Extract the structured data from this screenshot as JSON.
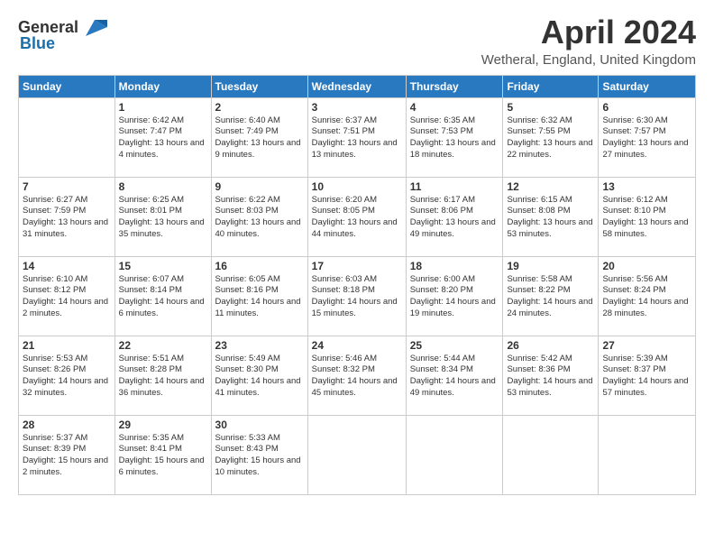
{
  "header": {
    "logo_general": "General",
    "logo_blue": "Blue",
    "title": "April 2024",
    "location": "Wetheral, England, United Kingdom"
  },
  "days_of_week": [
    "Sunday",
    "Monday",
    "Tuesday",
    "Wednesday",
    "Thursday",
    "Friday",
    "Saturday"
  ],
  "weeks": [
    [
      {
        "day": "",
        "sunrise": "",
        "sunset": "",
        "daylight": ""
      },
      {
        "day": "1",
        "sunrise": "Sunrise: 6:42 AM",
        "sunset": "Sunset: 7:47 PM",
        "daylight": "Daylight: 13 hours and 4 minutes."
      },
      {
        "day": "2",
        "sunrise": "Sunrise: 6:40 AM",
        "sunset": "Sunset: 7:49 PM",
        "daylight": "Daylight: 13 hours and 9 minutes."
      },
      {
        "day": "3",
        "sunrise": "Sunrise: 6:37 AM",
        "sunset": "Sunset: 7:51 PM",
        "daylight": "Daylight: 13 hours and 13 minutes."
      },
      {
        "day": "4",
        "sunrise": "Sunrise: 6:35 AM",
        "sunset": "Sunset: 7:53 PM",
        "daylight": "Daylight: 13 hours and 18 minutes."
      },
      {
        "day": "5",
        "sunrise": "Sunrise: 6:32 AM",
        "sunset": "Sunset: 7:55 PM",
        "daylight": "Daylight: 13 hours and 22 minutes."
      },
      {
        "day": "6",
        "sunrise": "Sunrise: 6:30 AM",
        "sunset": "Sunset: 7:57 PM",
        "daylight": "Daylight: 13 hours and 27 minutes."
      }
    ],
    [
      {
        "day": "7",
        "sunrise": "Sunrise: 6:27 AM",
        "sunset": "Sunset: 7:59 PM",
        "daylight": "Daylight: 13 hours and 31 minutes."
      },
      {
        "day": "8",
        "sunrise": "Sunrise: 6:25 AM",
        "sunset": "Sunset: 8:01 PM",
        "daylight": "Daylight: 13 hours and 35 minutes."
      },
      {
        "day": "9",
        "sunrise": "Sunrise: 6:22 AM",
        "sunset": "Sunset: 8:03 PM",
        "daylight": "Daylight: 13 hours and 40 minutes."
      },
      {
        "day": "10",
        "sunrise": "Sunrise: 6:20 AM",
        "sunset": "Sunset: 8:05 PM",
        "daylight": "Daylight: 13 hours and 44 minutes."
      },
      {
        "day": "11",
        "sunrise": "Sunrise: 6:17 AM",
        "sunset": "Sunset: 8:06 PM",
        "daylight": "Daylight: 13 hours and 49 minutes."
      },
      {
        "day": "12",
        "sunrise": "Sunrise: 6:15 AM",
        "sunset": "Sunset: 8:08 PM",
        "daylight": "Daylight: 13 hours and 53 minutes."
      },
      {
        "day": "13",
        "sunrise": "Sunrise: 6:12 AM",
        "sunset": "Sunset: 8:10 PM",
        "daylight": "Daylight: 13 hours and 58 minutes."
      }
    ],
    [
      {
        "day": "14",
        "sunrise": "Sunrise: 6:10 AM",
        "sunset": "Sunset: 8:12 PM",
        "daylight": "Daylight: 14 hours and 2 minutes."
      },
      {
        "day": "15",
        "sunrise": "Sunrise: 6:07 AM",
        "sunset": "Sunset: 8:14 PM",
        "daylight": "Daylight: 14 hours and 6 minutes."
      },
      {
        "day": "16",
        "sunrise": "Sunrise: 6:05 AM",
        "sunset": "Sunset: 8:16 PM",
        "daylight": "Daylight: 14 hours and 11 minutes."
      },
      {
        "day": "17",
        "sunrise": "Sunrise: 6:03 AM",
        "sunset": "Sunset: 8:18 PM",
        "daylight": "Daylight: 14 hours and 15 minutes."
      },
      {
        "day": "18",
        "sunrise": "Sunrise: 6:00 AM",
        "sunset": "Sunset: 8:20 PM",
        "daylight": "Daylight: 14 hours and 19 minutes."
      },
      {
        "day": "19",
        "sunrise": "Sunrise: 5:58 AM",
        "sunset": "Sunset: 8:22 PM",
        "daylight": "Daylight: 14 hours and 24 minutes."
      },
      {
        "day": "20",
        "sunrise": "Sunrise: 5:56 AM",
        "sunset": "Sunset: 8:24 PM",
        "daylight": "Daylight: 14 hours and 28 minutes."
      }
    ],
    [
      {
        "day": "21",
        "sunrise": "Sunrise: 5:53 AM",
        "sunset": "Sunset: 8:26 PM",
        "daylight": "Daylight: 14 hours and 32 minutes."
      },
      {
        "day": "22",
        "sunrise": "Sunrise: 5:51 AM",
        "sunset": "Sunset: 8:28 PM",
        "daylight": "Daylight: 14 hours and 36 minutes."
      },
      {
        "day": "23",
        "sunrise": "Sunrise: 5:49 AM",
        "sunset": "Sunset: 8:30 PM",
        "daylight": "Daylight: 14 hours and 41 minutes."
      },
      {
        "day": "24",
        "sunrise": "Sunrise: 5:46 AM",
        "sunset": "Sunset: 8:32 PM",
        "daylight": "Daylight: 14 hours and 45 minutes."
      },
      {
        "day": "25",
        "sunrise": "Sunrise: 5:44 AM",
        "sunset": "Sunset: 8:34 PM",
        "daylight": "Daylight: 14 hours and 49 minutes."
      },
      {
        "day": "26",
        "sunrise": "Sunrise: 5:42 AM",
        "sunset": "Sunset: 8:36 PM",
        "daylight": "Daylight: 14 hours and 53 minutes."
      },
      {
        "day": "27",
        "sunrise": "Sunrise: 5:39 AM",
        "sunset": "Sunset: 8:37 PM",
        "daylight": "Daylight: 14 hours and 57 minutes."
      }
    ],
    [
      {
        "day": "28",
        "sunrise": "Sunrise: 5:37 AM",
        "sunset": "Sunset: 8:39 PM",
        "daylight": "Daylight: 15 hours and 2 minutes."
      },
      {
        "day": "29",
        "sunrise": "Sunrise: 5:35 AM",
        "sunset": "Sunset: 8:41 PM",
        "daylight": "Daylight: 15 hours and 6 minutes."
      },
      {
        "day": "30",
        "sunrise": "Sunrise: 5:33 AM",
        "sunset": "Sunset: 8:43 PM",
        "daylight": "Daylight: 15 hours and 10 minutes."
      },
      {
        "day": "",
        "sunrise": "",
        "sunset": "",
        "daylight": ""
      },
      {
        "day": "",
        "sunrise": "",
        "sunset": "",
        "daylight": ""
      },
      {
        "day": "",
        "sunrise": "",
        "sunset": "",
        "daylight": ""
      },
      {
        "day": "",
        "sunrise": "",
        "sunset": "",
        "daylight": ""
      }
    ]
  ]
}
